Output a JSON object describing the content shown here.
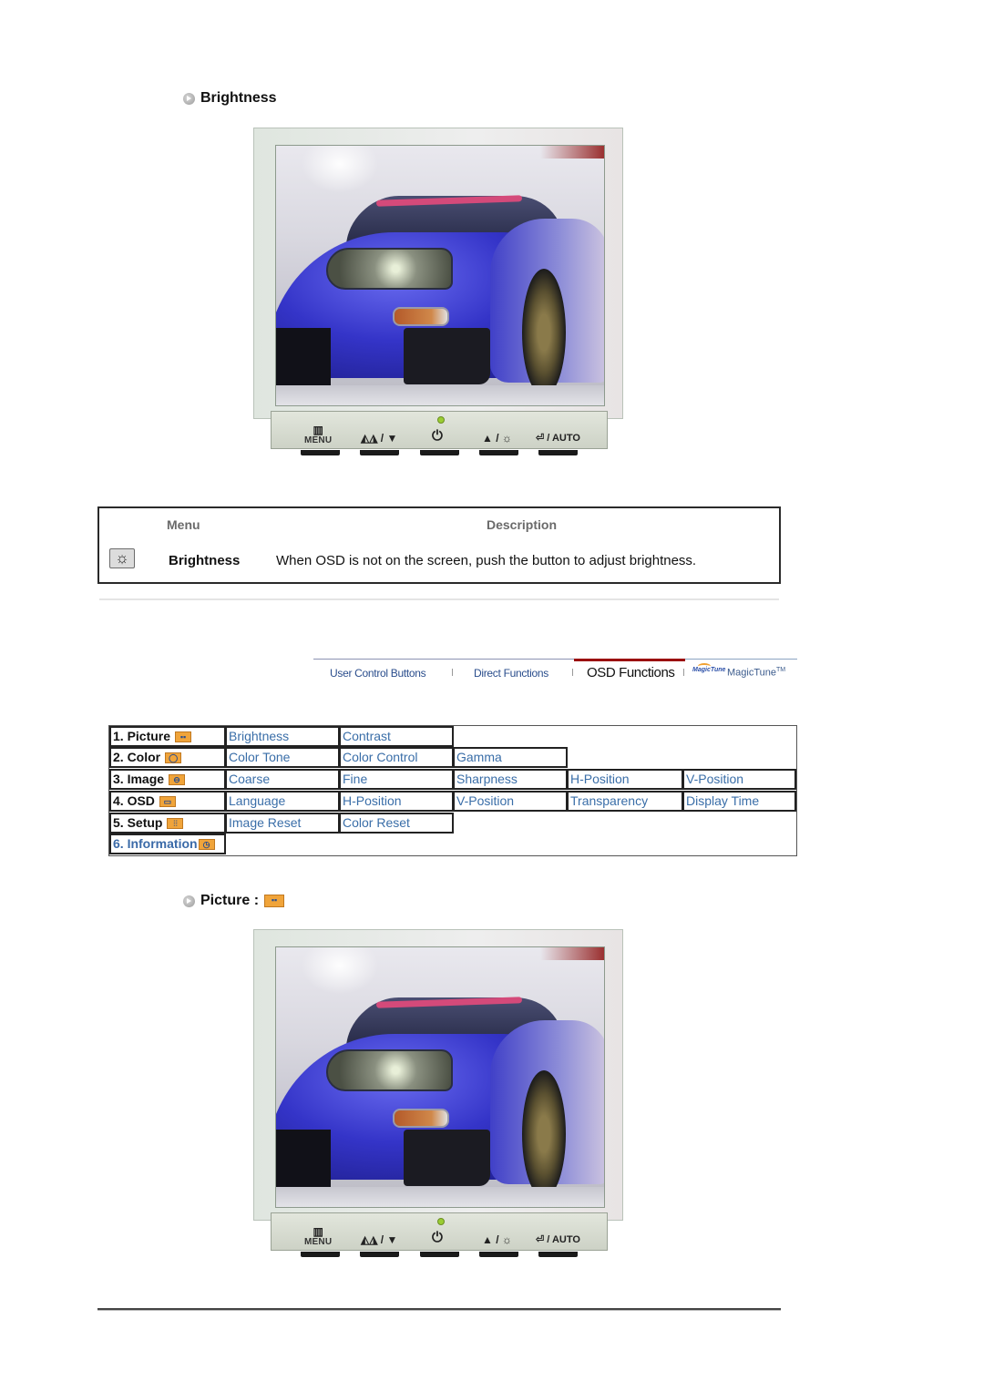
{
  "sections": {
    "brightness": {
      "title": "Brightness"
    },
    "picture": {
      "title": "Picture :"
    }
  },
  "monitor": {
    "buttons": [
      {
        "glyph": "▥",
        "label": "MENU",
        "icon": "menu-icon"
      },
      {
        "glyph": "◭◮ / ▼",
        "label": "",
        "icon": "magicbright-down-icon"
      },
      {
        "glyph": "⏻",
        "label": "",
        "icon": "power-icon"
      },
      {
        "glyph": "▲ / ☼",
        "label": "",
        "icon": "up-brightness-icon"
      },
      {
        "glyph": "⏎ / AUTO",
        "label": "",
        "icon": "enter-auto-icon"
      }
    ],
    "led_color": "#9acd32"
  },
  "desc_table": {
    "header_menu": "Menu",
    "header_description": "Description",
    "row": {
      "icon": "sun-brightness-icon",
      "menu": "Brightness",
      "description": "When OSD is not on the screen, push the button to adjust brightness."
    }
  },
  "tabnav": {
    "tabs": [
      {
        "label": "User Control Buttons",
        "active": false
      },
      {
        "label": "Direct Functions",
        "active": false
      },
      {
        "label": "OSD Functions",
        "active": true
      }
    ],
    "magictune_logo": "MagicTune",
    "magictune_label": "MagicTune",
    "magictune_tm": "TM",
    "active_color": "#9b0d0d",
    "link_color": "#2a4d8c"
  },
  "osd_menu": {
    "rows": [
      {
        "head": "1. Picture",
        "icon": "picture-icon",
        "items": [
          "Brightness",
          "Contrast"
        ]
      },
      {
        "head": "2. Color",
        "icon": "color-icon",
        "items": [
          "Color Tone",
          "Color Control",
          "Gamma"
        ]
      },
      {
        "head": "3. Image",
        "icon": "image-icon",
        "items": [
          "Coarse",
          "Fine",
          "Sharpness",
          "H-Position",
          "V-Position"
        ]
      },
      {
        "head": "4. OSD",
        "icon": "osd-icon",
        "items": [
          "Language",
          "H-Position",
          "V-Position",
          "Transparency",
          "Display Time"
        ]
      },
      {
        "head": "5. Setup",
        "icon": "setup-icon",
        "items": [
          "Image Reset",
          "Color Reset"
        ]
      },
      {
        "head": "6. Information",
        "icon": "information-icon",
        "items": []
      }
    ],
    "link_color": "#3a6ea8",
    "icon_color": "#f0a43a"
  }
}
